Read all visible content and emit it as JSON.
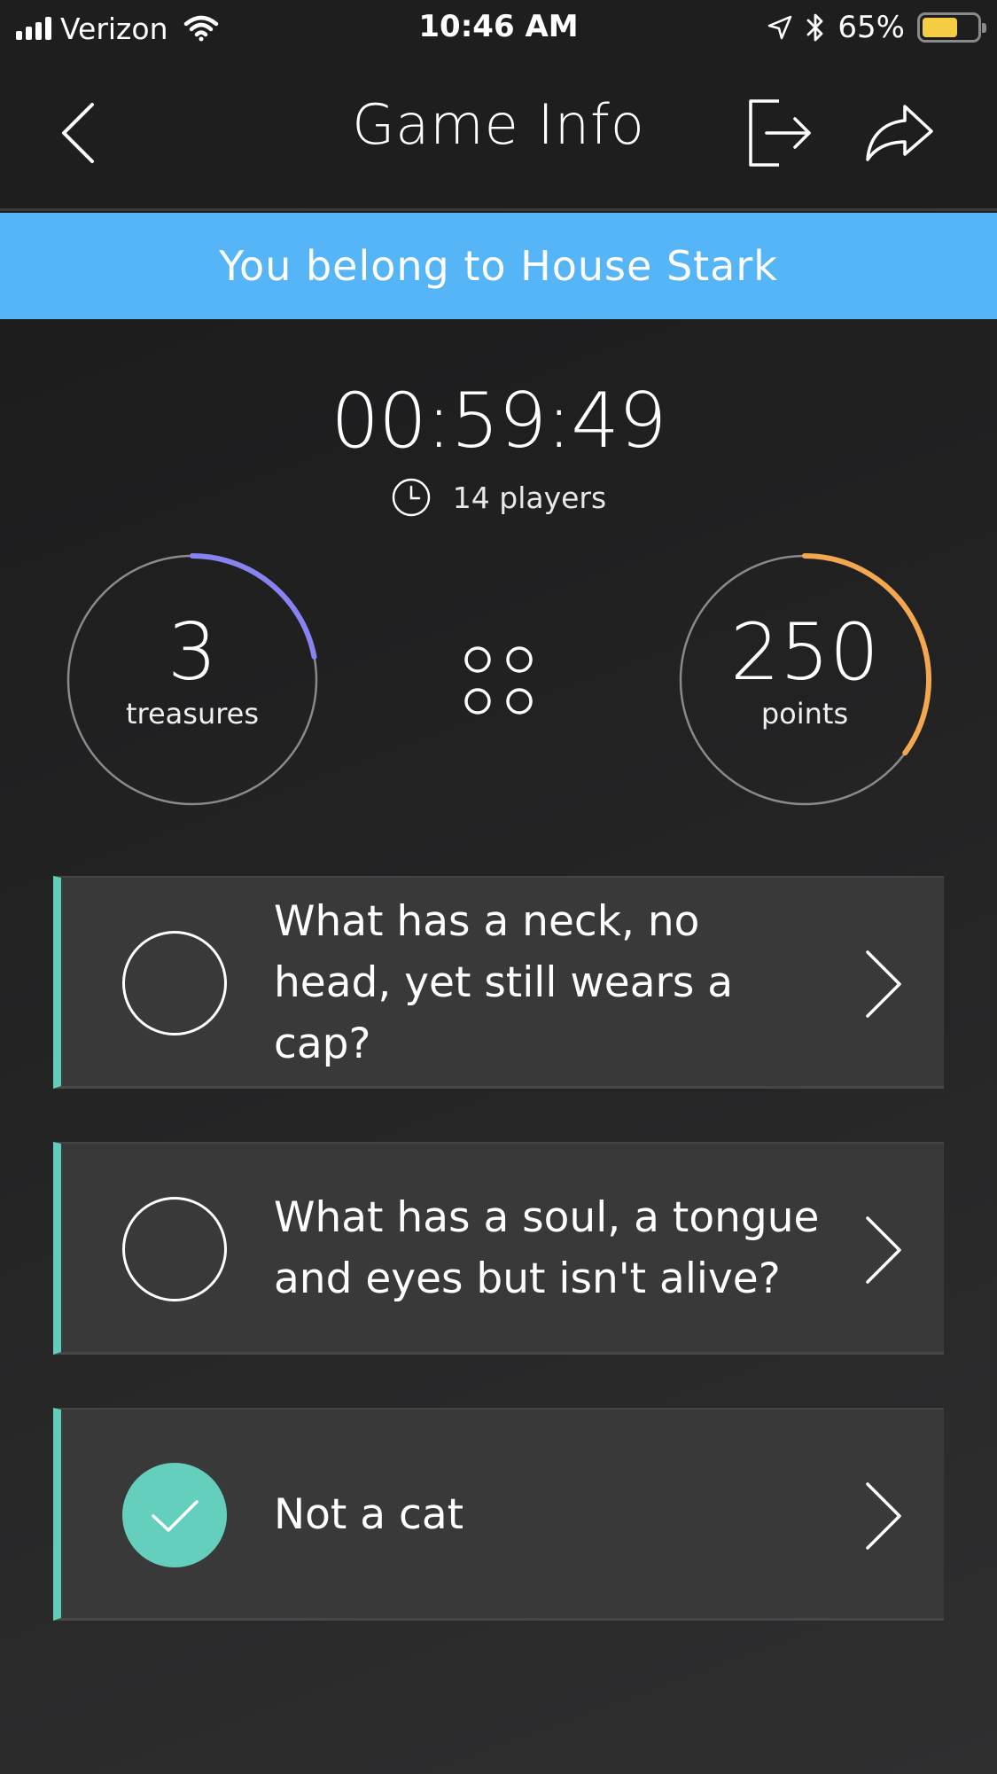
{
  "status_bar": {
    "carrier": "Verizon",
    "time": "10:46 AM",
    "battery_percent": "65%",
    "battery_level": 0.65,
    "icons": [
      "signal-icon",
      "wifi-icon",
      "location-arrow-icon",
      "bluetooth-icon",
      "battery-icon"
    ]
  },
  "nav": {
    "title": "Game Info",
    "icons": [
      "back-chevron-icon",
      "exit-icon",
      "share-icon"
    ]
  },
  "banner": {
    "text": "You belong to House Stark",
    "color": "#56b5f7"
  },
  "stats": {
    "timer": "00:59:49",
    "players": "14 players",
    "treasures": {
      "value": "3",
      "label": "treasures",
      "progress": 0.22,
      "color": "#8783f2"
    },
    "points": {
      "value": "250",
      "label": "points",
      "progress": 0.35,
      "color": "#f3a850"
    }
  },
  "questions": [
    {
      "text": "What has a neck, no head, yet still wears a cap?",
      "completed": false
    },
    {
      "text": "What has a soul, a tongue and eyes but isn't alive?",
      "completed": false
    },
    {
      "text": "Not a cat",
      "completed": true
    }
  ],
  "colors": {
    "accent_teal": "#5fcdb7",
    "card_background": "#39393a",
    "background": "#1c1c1d"
  }
}
